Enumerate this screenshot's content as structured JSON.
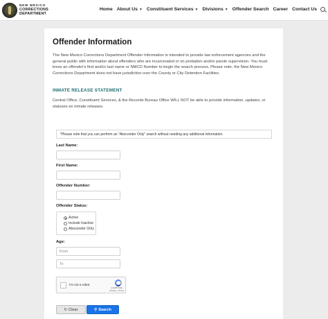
{
  "header": {
    "logo": {
      "line1": "NEW MEXICO",
      "line2": "CORRECTIONS",
      "line3": "DEPARTMENT"
    },
    "nav": [
      {
        "label": "Home",
        "dropdown": false
      },
      {
        "label": "About Us",
        "dropdown": true
      },
      {
        "label": "Constituent Services",
        "dropdown": true
      },
      {
        "label": "Divisions",
        "dropdown": true
      },
      {
        "label": "Offender Search",
        "dropdown": false
      },
      {
        "label": "Career",
        "dropdown": false
      },
      {
        "label": "Contact Us",
        "dropdown": false
      }
    ],
    "search_icon": "search-icon"
  },
  "main": {
    "title": "Offender Information",
    "intro": "The New Mexico Corrections Department Offender Information is intended to provide law enforcement agencies and the general public with information about offenders who are incarcerated or on probation and/or parole supervision. You must know an offender's first and/or last name or NMCD Number to begin the search process. Please note, the New Mexico Corrections Department does not have jurisdiction over the County or City Detention Facilities.",
    "release_heading": "INMATE RELEASE STATEMENT",
    "release_text": "Central Office, Constituent Services, & the Records Bureau Office WILL NOT be able to provide information, updates, or statuses on inmate releases."
  },
  "form": {
    "notice": "*Please note that you can perform an \"Absconder Only\" search without needing any additional information.",
    "last_name_label": "Last Name:",
    "last_name_value": "",
    "first_name_label": "First Name:",
    "first_name_value": "",
    "offender_number_label": "Offender Number:",
    "offender_number_value": "",
    "status_label": "Offender Status:",
    "status_options": [
      {
        "label": "Active",
        "selected": true
      },
      {
        "label": "Include Inactive",
        "selected": false
      },
      {
        "label": "Absconder Only",
        "selected": false
      }
    ],
    "age_label": "Age:",
    "age_from_placeholder": "From",
    "age_to_placeholder": "To",
    "captcha_label": "I'm not a robot",
    "captcha_brand": "reCAPTCHA",
    "captcha_links": "Privacy - Terms",
    "clear_label": "Clear",
    "search_label": "Search"
  },
  "colors": {
    "accent": "#1a73e8",
    "heading_teal": "#1e6f73",
    "background": "#ececec"
  }
}
